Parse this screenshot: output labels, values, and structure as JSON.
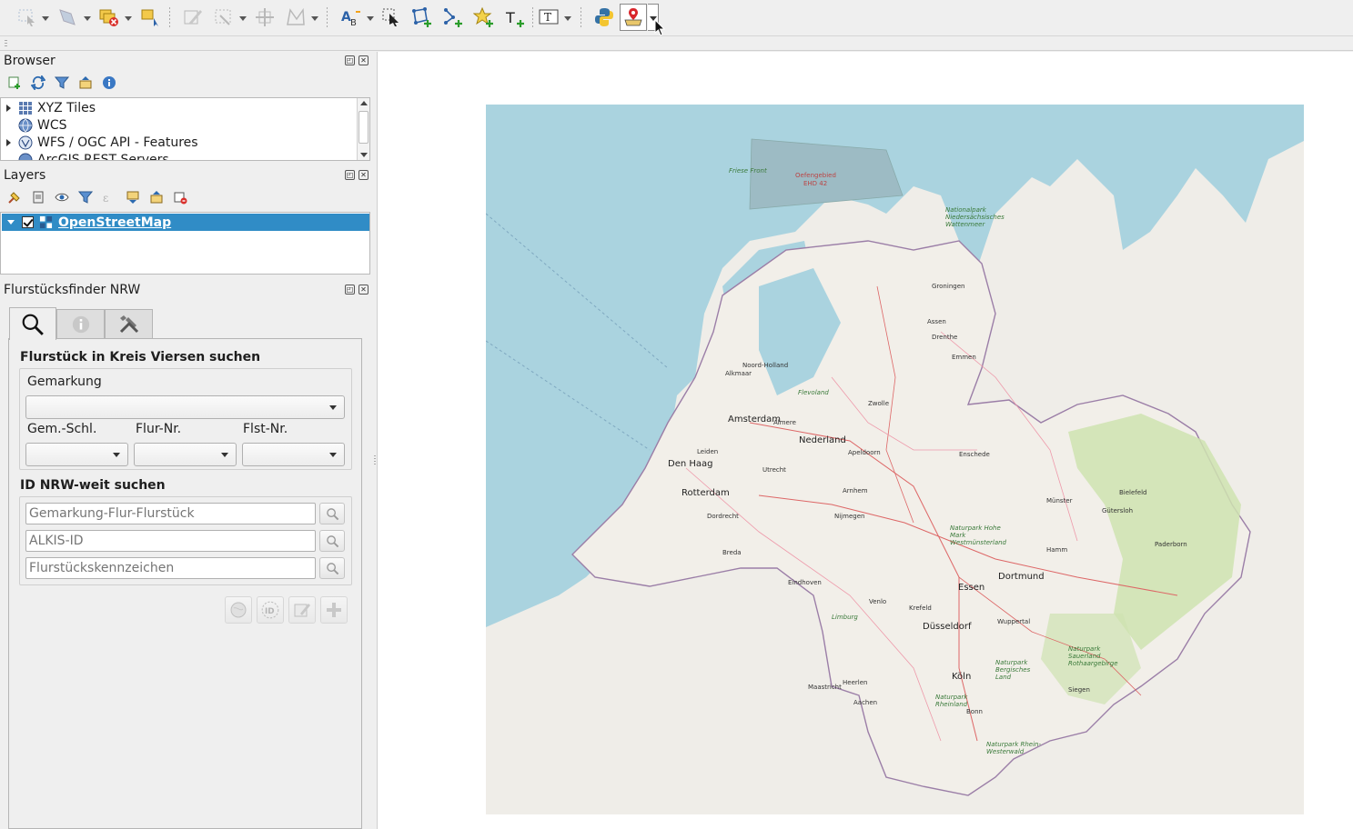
{
  "browser": {
    "title": "Browser",
    "items": [
      {
        "label": "XYZ Tiles",
        "expandable": true,
        "icon": "grid-icon"
      },
      {
        "label": "WCS",
        "expandable": false,
        "icon": "globe-icon"
      },
      {
        "label": "WFS / OGC API - Features",
        "expandable": true,
        "icon": "globe-icon"
      },
      {
        "label": "ArcGIS REST Servers",
        "expandable": false,
        "icon": "globe-icon"
      }
    ]
  },
  "layers": {
    "title": "Layers",
    "items": [
      {
        "label": "OpenStreetMap",
        "checked": true,
        "selected": true
      }
    ]
  },
  "finder": {
    "title": "Flurstücksfinder NRW",
    "section1_title": "Flurstück in Kreis Viersen suchen",
    "gemarkung_label": "Gemarkung",
    "gemarkung_value": "",
    "gem_schl_label": "Gem.-Schl.",
    "flur_nr_label": "Flur-Nr.",
    "flst_nr_label": "Flst-Nr.",
    "section2_title": "ID NRW-weit suchen",
    "input1_placeholder": "Gemarkung-Flur-Flurstück",
    "input2_placeholder": "ALKIS-ID",
    "input3_placeholder": "Flurstückskennzeichen"
  },
  "map": {
    "labels": [
      {
        "text": "Friese Front",
        "kind": "green"
      },
      {
        "text": "Oefengebied",
        "kind": "red"
      },
      {
        "text": "EHD 42",
        "kind": "red"
      },
      {
        "text": "Nationalpark Niedersächsisches Wattenmeer",
        "kind": "green"
      },
      {
        "text": "Groningen",
        "kind": "city"
      },
      {
        "text": "Assen",
        "kind": "city"
      },
      {
        "text": "Drenthe",
        "kind": "city"
      },
      {
        "text": "Emmen",
        "kind": "city"
      },
      {
        "text": "Noord-Holland",
        "kind": "city"
      },
      {
        "text": "Alkmaar",
        "kind": "city"
      },
      {
        "text": "Flevoland",
        "kind": "green"
      },
      {
        "text": "Amsterdam",
        "kind": "big"
      },
      {
        "text": "Almere",
        "kind": "city"
      },
      {
        "text": "Zwolle",
        "kind": "city"
      },
      {
        "text": "Nederland",
        "kind": "big"
      },
      {
        "text": "Den Haag",
        "kind": "big"
      },
      {
        "text": "Leiden",
        "kind": "city"
      },
      {
        "text": "Utrecht",
        "kind": "city"
      },
      {
        "text": "Apeldoorn",
        "kind": "city"
      },
      {
        "text": "Enschede",
        "kind": "city"
      },
      {
        "text": "Rotterdam",
        "kind": "big"
      },
      {
        "text": "Arnhem",
        "kind": "city"
      },
      {
        "text": "Nijmegen",
        "kind": "city"
      },
      {
        "text": "Dordrecht",
        "kind": "city"
      },
      {
        "text": "Münster",
        "kind": "city"
      },
      {
        "text": "Bielefeld",
        "kind": "city"
      },
      {
        "text": "Gütersloh",
        "kind": "city"
      },
      {
        "text": "Breda",
        "kind": "city"
      },
      {
        "text": "Eindhoven",
        "kind": "city"
      },
      {
        "text": "Essen",
        "kind": "big"
      },
      {
        "text": "Dortmund",
        "kind": "big"
      },
      {
        "text": "Hamm",
        "kind": "city"
      },
      {
        "text": "Paderborn",
        "kind": "city"
      },
      {
        "text": "Düsseldorf",
        "kind": "big"
      },
      {
        "text": "Wuppertal",
        "kind": "city"
      },
      {
        "text": "Krefeld",
        "kind": "city"
      },
      {
        "text": "Köln",
        "kind": "big"
      },
      {
        "text": "Bonn",
        "kind": "city"
      },
      {
        "text": "Siegen",
        "kind": "city"
      },
      {
        "text": "Aachen",
        "kind": "city"
      },
      {
        "text": "Maastricht",
        "kind": "city"
      },
      {
        "text": "Heerlen",
        "kind": "city"
      },
      {
        "text": "Venlo",
        "kind": "city"
      },
      {
        "text": "Limburg",
        "kind": "green"
      },
      {
        "text": "Naturpark Hohe Mark Westmünsterland",
        "kind": "green"
      },
      {
        "text": "Naturpark Sauerland Rothaargebirge",
        "kind": "green"
      },
      {
        "text": "Naturpark Rheinland",
        "kind": "green"
      },
      {
        "text": "Naturpark Rhein-Westerwald",
        "kind": "green"
      },
      {
        "text": "Naturpark Bergisches Land",
        "kind": "green"
      }
    ],
    "colors": {
      "sea": "#aad3df",
      "land": "#f2efe9",
      "green": "#cfe3b0"
    }
  }
}
